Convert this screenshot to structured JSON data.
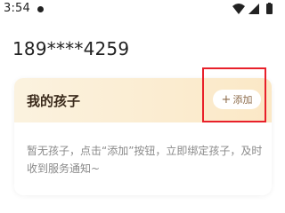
{
  "status_bar": {
    "time": "3:54",
    "icons": [
      "wifi-icon",
      "signal-icon",
      "battery-icon"
    ]
  },
  "account": {
    "phone": "189****4259"
  },
  "kids_card": {
    "title": "我的孩子",
    "add_button_label": "添加",
    "add_button_icon": "+",
    "empty_message": "暂无孩子，点击“添加”按钮，立即绑定孩子，及时收到服务通知~"
  },
  "colors": {
    "header_gradient_start": "#fbf2df",
    "header_gradient_end": "#fbe8c6",
    "highlight": "#e8202a",
    "title_text": "#3b2b1c",
    "button_text": "#8c6b4a",
    "hint_text": "#8a8a8a"
  }
}
